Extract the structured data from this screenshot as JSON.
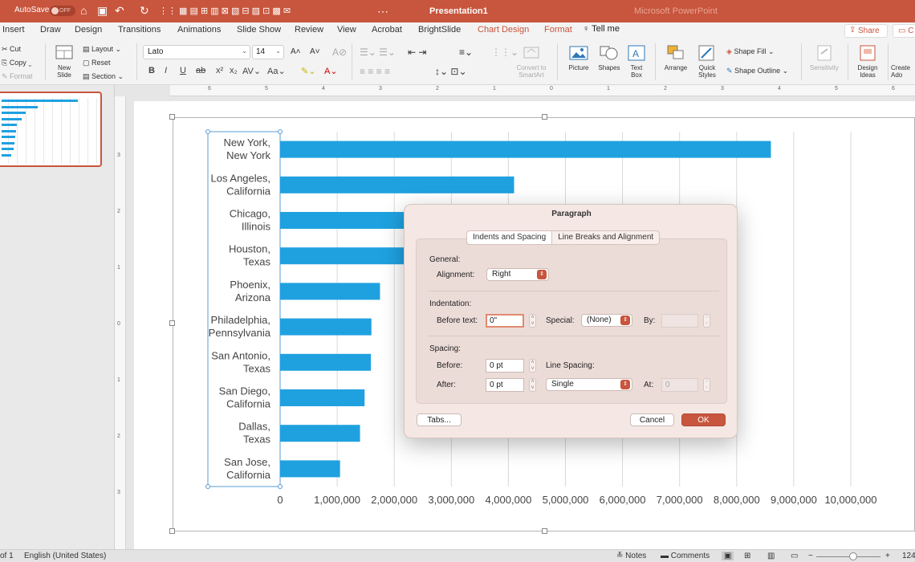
{
  "titlebar": {
    "autosave": "AutoSave",
    "autosave_state": "OFF",
    "title": "Presentation1",
    "faded_filename": "Microsoft PowerPoint"
  },
  "tabs": [
    {
      "label": "Insert",
      "contextual": false
    },
    {
      "label": "Draw",
      "contextual": false
    },
    {
      "label": "Design",
      "contextual": false
    },
    {
      "label": "Transitions",
      "contextual": false
    },
    {
      "label": "Animations",
      "contextual": false
    },
    {
      "label": "Slide Show",
      "contextual": false
    },
    {
      "label": "Review",
      "contextual": false
    },
    {
      "label": "View",
      "contextual": false
    },
    {
      "label": "Acrobat",
      "contextual": false
    },
    {
      "label": "BrightSlide",
      "contextual": false
    },
    {
      "label": "Chart Design",
      "contextual": true
    },
    {
      "label": "Format",
      "contextual": true
    }
  ],
  "tell_me": "Tell me",
  "share": "Share",
  "comments_short": "C",
  "ribbon": {
    "cut": "Cut",
    "copy": "Copy",
    "format": "Format",
    "new_slide": "New Slide",
    "layout": "Layout",
    "reset": "Reset",
    "section": "Section",
    "font": "Lato",
    "font_size": "14",
    "convert_smartart": "Convert to SmartArt",
    "picture": "Picture",
    "shapes": "Shapes",
    "text_box": "Text Box",
    "arrange": "Arrange",
    "quick_styles": "Quick Styles",
    "shape_fill": "Shape Fill",
    "shape_outline": "Shape Outline",
    "sensitivity": "Sensitivity",
    "design_ideas": "Design Ideas",
    "create": "Create Ado"
  },
  "ruler": {
    "h": [
      "6",
      "5",
      "4",
      "3",
      "2",
      "1",
      "0",
      "1",
      "2",
      "3",
      "4",
      "5",
      "6"
    ],
    "v": [
      "3",
      "2",
      "1",
      "0",
      "1",
      "2",
      "3"
    ]
  },
  "chart_data": {
    "type": "bar",
    "orientation": "horizontal",
    "categories": [
      [
        "New York,",
        "New York"
      ],
      [
        "Los Angeles,",
        "California"
      ],
      [
        "Chicago,",
        "Illinois"
      ],
      [
        "Houston,",
        "Texas"
      ],
      [
        "Phoenix,",
        "Arizona"
      ],
      [
        "Philadelphia,",
        "Pennsylvania"
      ],
      [
        "San Antonio,",
        "Texas"
      ],
      [
        "San Diego,",
        "California"
      ],
      [
        "Dallas,",
        "Texas"
      ],
      [
        "San Jose,",
        "California"
      ]
    ],
    "values": [
      8600000,
      4100000,
      2700000,
      2300000,
      1750000,
      1600000,
      1590000,
      1480000,
      1400000,
      1050000
    ],
    "xlim": [
      0,
      10000000
    ],
    "x_ticks": [
      "0",
      "1,000,000",
      "2,000,000",
      "3,000,000",
      "4,000,000",
      "5,000,000",
      "6,000,000",
      "7,000,000",
      "8,000,000",
      "9,000,000",
      "10,000,000"
    ],
    "grid": "vertical",
    "bar_color": "#1FA1E0"
  },
  "dialog": {
    "title": "Paragraph",
    "tab_active": "Indents and Spacing",
    "tab_other": "Line Breaks and Alignment",
    "general": "General:",
    "alignment_label": "Alignment:",
    "alignment_value": "Right",
    "indentation": "Indentation:",
    "before_text_label": "Before text:",
    "before_text_value": "0\"",
    "special_label": "Special:",
    "special_value": "(None)",
    "by_label": "By:",
    "spacing": "Spacing:",
    "before_label": "Before:",
    "before_value": "0 pt",
    "line_spacing_label": "Line Spacing:",
    "after_label": "After:",
    "after_value": "0 pt",
    "line_spacing_value": "Single",
    "at_label": "At:",
    "at_value": "0",
    "tabs_button": "Tabs...",
    "cancel_button": "Cancel",
    "ok_button": "OK"
  },
  "statusbar": {
    "slide": "of 1",
    "language": "English (United States)",
    "notes": "Notes",
    "comments": "Comments",
    "zoom": "124"
  }
}
